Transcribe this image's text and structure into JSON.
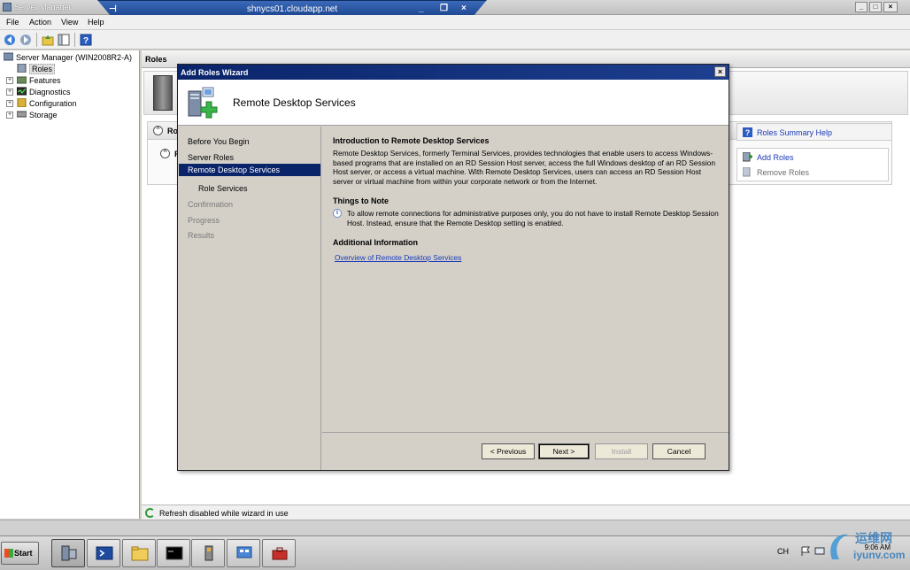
{
  "outer_window": {
    "title": "Server Manager",
    "rdp_host": "shnycs01.cloudapp.net",
    "controls": [
      "_",
      "□",
      "×"
    ]
  },
  "menu": [
    "File",
    "Action",
    "View",
    "Help"
  ],
  "tree": {
    "root": "Server Manager (WIN2008R2-A)",
    "items": [
      "Roles",
      "Features",
      "Diagnostics",
      "Configuration",
      "Storage"
    ]
  },
  "right_panel": {
    "header": "Roles",
    "summary_head_partial": "Ro",
    "row_partial": "R",
    "help_link": "Roles Summary Help",
    "add_roles": "Add Roles",
    "remove_roles": "Remove Roles"
  },
  "status": {
    "text": "Refresh disabled while wizard in use"
  },
  "wizard": {
    "title": "Add Roles Wizard",
    "header_title": "Remote Desktop Services",
    "nav": [
      {
        "label": "Before You Begin",
        "state": "normal"
      },
      {
        "label": "Server Roles",
        "state": "normal"
      },
      {
        "label": "Remote Desktop Services",
        "state": "selected"
      },
      {
        "label": "Role Services",
        "state": "normal"
      },
      {
        "label": "Confirmation",
        "state": "dim"
      },
      {
        "label": "Progress",
        "state": "dim"
      },
      {
        "label": "Results",
        "state": "dim"
      }
    ],
    "content": {
      "intro_heading": "Introduction to Remote Desktop Services",
      "intro_text": "Remote Desktop Services, formerly Terminal Services, provides technologies that enable users to access Windows-based programs that are installed on an RD Session Host server, access the full Windows desktop of an RD Session Host server, or access a virtual machine. With Remote Desktop Services, users can access an RD Session Host server or virtual machine from within your corporate network or from the Internet.",
      "note_heading": "Things to Note",
      "note_text": "To allow remote connections for administrative purposes only, you do not have to install Remote Desktop Session Host. Instead, ensure that the Remote Desktop setting is enabled.",
      "additional_heading": "Additional Information",
      "link_text": "Overview of Remote Desktop Services"
    },
    "buttons": {
      "previous": "< Previous",
      "next": "Next >",
      "install": "Install",
      "cancel": "Cancel"
    }
  },
  "taskbar": {
    "start": "Start",
    "tray_lang": "CH",
    "tray_time": "9:06 AM"
  },
  "watermark": {
    "text_cn": "运维网",
    "text_en": "iyunv.com"
  },
  "colors": {
    "wizard_title": "#0a246a",
    "nav_selected": "#0a246a",
    "link": "#1a3ab8",
    "disabled": "#7a7a7a"
  }
}
